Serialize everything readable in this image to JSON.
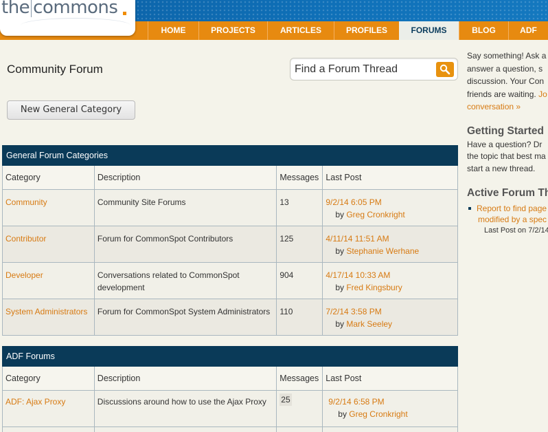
{
  "logo": {
    "part1": "the",
    "part2": "commons"
  },
  "nav": [
    {
      "label": "HOME"
    },
    {
      "label": "PROJECTS"
    },
    {
      "label": "ARTICLES"
    },
    {
      "label": "PROFILES"
    },
    {
      "label": "FORUMS",
      "active": true
    },
    {
      "label": "BLOG"
    },
    {
      "label": "ADF"
    }
  ],
  "page": {
    "title": "Community Forum",
    "search_placeholder": "Find a Forum Thread",
    "new_category_button": "New General Category"
  },
  "general": {
    "caption": "General Forum Categories",
    "headers": [
      "Category",
      "Description",
      "Messages",
      "Last Post"
    ],
    "rows": [
      {
        "category": "Community",
        "description": "Community Site Forums",
        "messages": "13",
        "last_post": "9/2/14 6:05 PM",
        "by_prefix": "by",
        "author": "Greg Cronkright"
      },
      {
        "category": "Contributor",
        "description": "Forum for CommonSpot Contributors",
        "messages": "125",
        "last_post": "4/11/14 11:51 AM",
        "by_prefix": "by",
        "author": "Stephanie Werhane"
      },
      {
        "category": "Developer",
        "description": "Conversations related to CommonSpot development",
        "messages": "904",
        "last_post": "4/17/14 10:33 AM",
        "by_prefix": "by",
        "author": "Fred Kingsbury"
      },
      {
        "category": "System Administrators",
        "description": "Forum for CommonSpot System Administrators",
        "messages": "110",
        "last_post": "7/2/14 3:58 PM",
        "by_prefix": "by",
        "author": "Mark Seeley"
      }
    ]
  },
  "adf": {
    "caption": "ADF Forums",
    "headers": [
      "Category",
      "Description",
      "Messages",
      "Last Post"
    ],
    "rows": [
      {
        "category": "ADF: Ajax Proxy",
        "description": "Discussions around how to use the Ajax Proxy",
        "messages": "25",
        "last_post": "9/2/14 6:58 PM",
        "by_prefix": "by",
        "author": "Greg Cronkright"
      }
    ]
  },
  "sidebar": {
    "intro": [
      "Say something! Ask a",
      "answer a question, s",
      "discussion. Your Con",
      "friends are waiting."
    ],
    "intro_link_tail": "Jo",
    "intro_link": "conversation »",
    "getting_started_title": "Getting Started",
    "getting_started_lines": [
      "Have a question?  Dr",
      "the topic that best ma",
      "start a new thread."
    ],
    "active_title": "Active Forum Th",
    "active_item_lines": [
      "Report to find page",
      "modified by a spec"
    ],
    "active_item_meta": "Last Post on 7/2/14"
  }
}
